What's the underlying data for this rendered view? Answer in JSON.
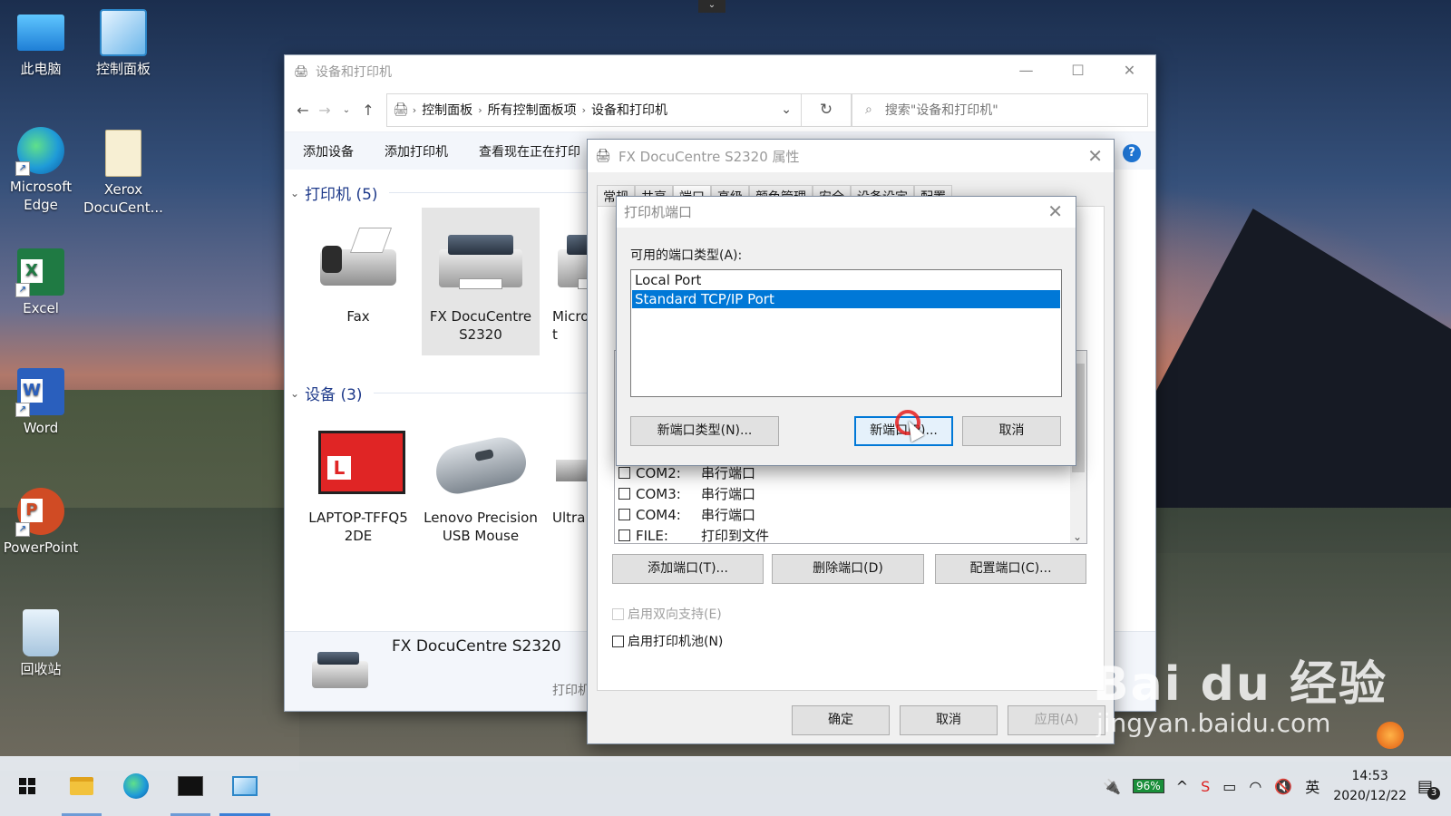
{
  "desktop": {
    "icons": [
      {
        "label": "此电脑"
      },
      {
        "label": "控制面板"
      },
      {
        "label": "Microsoft Edge"
      },
      {
        "label": "Xerox DocuCent..."
      },
      {
        "label": "Excel"
      },
      {
        "label": "Word"
      },
      {
        "label": "PowerPoint"
      },
      {
        "label": "回收站"
      }
    ],
    "watermark": {
      "line1": "Bai du 经验",
      "line2": "jingyan.baidu.com"
    }
  },
  "explorer": {
    "title": "设备和打印机",
    "breadcrumb": [
      "控制面板",
      "所有控制面板项",
      "设备和打印机"
    ],
    "search_placeholder": "搜索\"设备和打印机\"",
    "commands": [
      "添加设备",
      "添加打印机",
      "查看现在正在打印"
    ],
    "groups": {
      "printers": "打印机 (5)",
      "devices": "设备 (3)"
    },
    "printers": [
      {
        "name": "Fax"
      },
      {
        "name": "FX DocuCentre S2320"
      },
      {
        "name": "Micro t"
      }
    ],
    "devices": [
      {
        "name": "LAPTOP-TFFQ5 2DE"
      },
      {
        "name": "Lenovo Precision USB Mouse"
      },
      {
        "name": "Ultra"
      }
    ],
    "detail": {
      "name": "FX DocuCentre S2320",
      "sub": "打印机"
    }
  },
  "properties": {
    "title": "FX DocuCentre S2320 属性",
    "tabs": [
      "常规",
      "共享",
      "端口",
      "高级",
      "颜色管理",
      "安全",
      "设备设定",
      "配置"
    ],
    "ports": [
      {
        "name": "COM2:",
        "desc": "串行端口"
      },
      {
        "name": "COM3:",
        "desc": "串行端口"
      },
      {
        "name": "COM4:",
        "desc": "串行端口"
      },
      {
        "name": "FILE:",
        "desc": "打印到文件"
      }
    ],
    "add_port": "添加端口(T)...",
    "delete_port": "删除端口(D)",
    "config_port": "配置端口(C)...",
    "bidi": "启用双向支持(E)",
    "pool": "启用打印机池(N)",
    "ok": "确定",
    "cancel": "取消",
    "apply": "应用(A)"
  },
  "printer_ports": {
    "title": "打印机端口",
    "label": "可用的端口类型(A):",
    "types": [
      "Local Port",
      "Standard TCP/IP Port"
    ],
    "selected_index": 1,
    "new_type": "新端口类型(N)...",
    "new_port": "新端口(P)...",
    "cancel": "取消"
  },
  "taskbar": {
    "battery": "96%",
    "ime": "英",
    "time": "14:53",
    "date": "2020/12/22",
    "notifications": "3"
  }
}
